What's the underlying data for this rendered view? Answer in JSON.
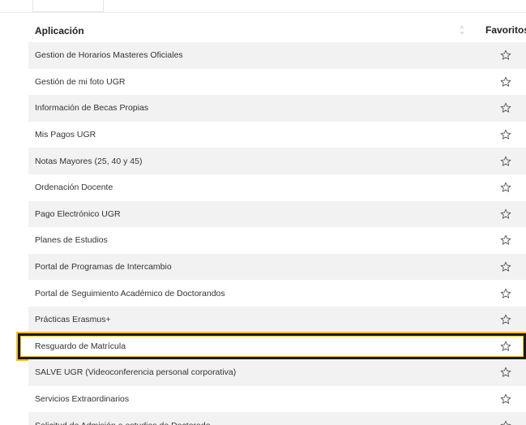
{
  "table": {
    "header": {
      "application_label": "Aplicación",
      "favorites_label": "Favoritos"
    },
    "rows": [
      {
        "name": "Gestion de Horarios Masteres Oficiales"
      },
      {
        "name": "Gestión de mi foto UGR"
      },
      {
        "name": "Información de Becas Propias"
      },
      {
        "name": "Mis Pagos UGR"
      },
      {
        "name": "Notas Mayores (25, 40 y 45)"
      },
      {
        "name": "Ordenación Docente"
      },
      {
        "name": "Pago Electrónico UGR"
      },
      {
        "name": "Planes de Estudios"
      },
      {
        "name": "Portal de Programas de Intercambio"
      },
      {
        "name": "Portal de Seguimiento Académico de Doctorandos"
      },
      {
        "name": "Prácticas Erasmus+"
      },
      {
        "name": "Resguardo de Matrícula"
      },
      {
        "name": "SALVE UGR (Videoconferencia personal corporativa)"
      },
      {
        "name": "Servicios Extraordinarios"
      },
      {
        "name": "Solicitud de Admisión a estudios de Doctorado"
      }
    ],
    "highlighted_row": "Resguardo de Matrícula",
    "icons": {
      "sort": "sort-icon",
      "favorite": "star-outline-icon"
    },
    "colors": {
      "stripe": "#f2f2f2",
      "highlight_outer": "#1a1a1a",
      "highlight_inner": "#f0c419"
    }
  }
}
